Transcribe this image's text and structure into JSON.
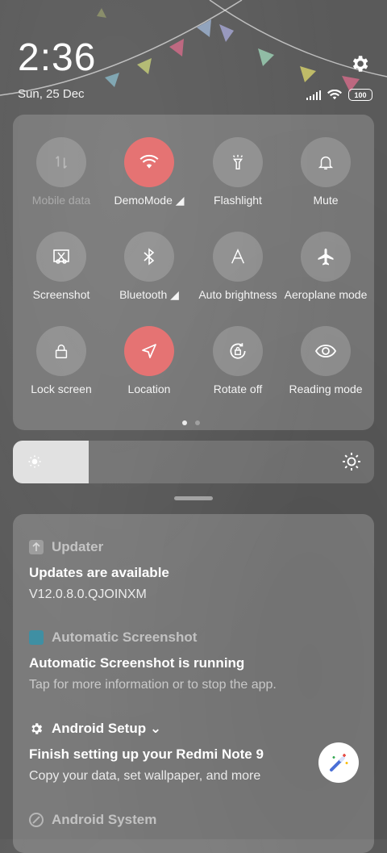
{
  "header": {
    "time": "2:36",
    "date": "Sun, 25 Dec",
    "battery": "100"
  },
  "tiles": [
    {
      "label": "Mobile data",
      "icon": "mobile-data-icon",
      "state": "disabled"
    },
    {
      "label": "DemoMode ◢",
      "icon": "wifi-icon",
      "state": "active"
    },
    {
      "label": "Flashlight",
      "icon": "flashlight-icon",
      "state": "off"
    },
    {
      "label": "Mute",
      "icon": "bell-icon",
      "state": "off"
    },
    {
      "label": "Screenshot",
      "icon": "screenshot-icon",
      "state": "off"
    },
    {
      "label": "Bluetooth ◢",
      "icon": "bluetooth-icon",
      "state": "off"
    },
    {
      "label": "Auto brightness",
      "icon": "auto-brightness-icon",
      "state": "off"
    },
    {
      "label": "Aeroplane mode",
      "icon": "airplane-icon",
      "state": "off"
    },
    {
      "label": "Lock screen",
      "icon": "lock-icon",
      "state": "off"
    },
    {
      "label": "Location",
      "icon": "location-icon",
      "state": "active"
    },
    {
      "label": "Rotate off",
      "icon": "rotate-lock-icon",
      "state": "off"
    },
    {
      "label": "Reading mode",
      "icon": "eye-icon",
      "state": "off"
    }
  ],
  "brightness": {
    "level": 0.21
  },
  "notifications": [
    {
      "app": "Updater",
      "title": "Updates are available",
      "body": "V12.0.8.0.QJOINXM"
    },
    {
      "app": "Automatic Screenshot",
      "title": "Automatic Screenshot is running",
      "body": "Tap for more information or to stop the app."
    },
    {
      "app": "Android Setup ⌄",
      "title": "Finish setting up your Redmi Note 9",
      "body": "Copy your data, set wallpaper, and more"
    },
    {
      "app": "Android System",
      "title": "",
      "body": ""
    }
  ],
  "colors": {
    "active": "#e57373",
    "accent_teal": "#3f8fa3"
  }
}
